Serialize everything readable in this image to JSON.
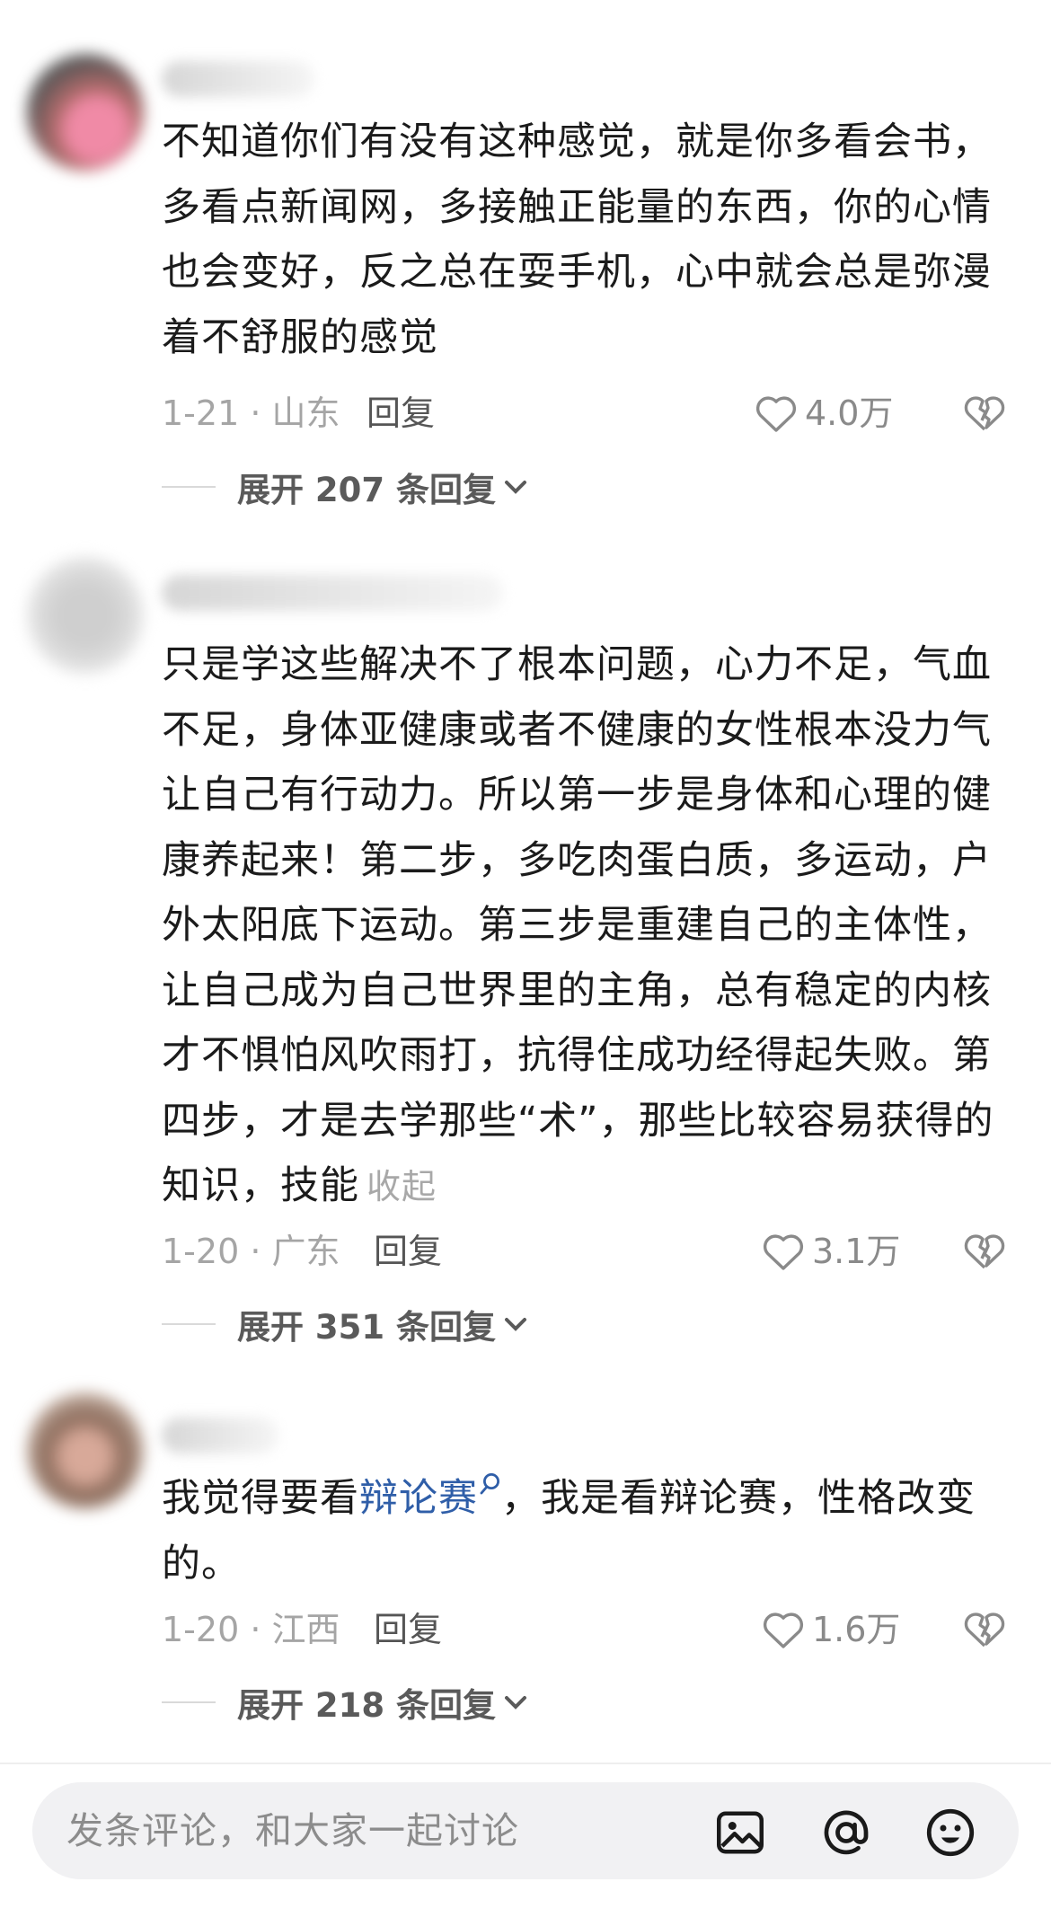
{
  "comments": [
    {
      "text": "不知道你们有没有这种感觉，就是你多看会书，多看点新闻网，多接触正能量的东西，你的心情也会变好，反之总在耍手机，心中就会总是弥漫着不舒服的感觉",
      "date_location": "1-21 · 山东",
      "reply_label": "回复",
      "likes": "4.0万",
      "expand_label": "展开 207 条回复"
    },
    {
      "text": "只是学这些解决不了根本问题，心力不足，气血不足，身体亚健康或者不健康的女性根本没力气让自己有行动力。所以第一步是身体和心理的健康养起来！第二步，多吃肉蛋白质，多运动，户外太阳底下运动。第三步是重建自己的主体性，让自己成为自己世界里的主角，总有稳定的内核才不惧怕风吹雨打，抗得住成功经得起失败。第四步，才是去学那些“术”，那些比较容易获得的知识，技能",
      "collapse_label": "收起",
      "date_location": "1-20 · 广东",
      "reply_label": "回复",
      "likes": "3.1万",
      "expand_label": "展开 351 条回复"
    },
    {
      "text_before": "我觉得要看",
      "link_text": "辩论赛",
      "text_after": "，我是看辩论赛，性格改变的。",
      "date_location": "1-20 · 江西",
      "reply_label": "回复",
      "likes": "1.6万",
      "expand_label": "展开 218 条回复"
    }
  ],
  "comment_input": {
    "placeholder": "发条评论，和大家一起讨论"
  },
  "icons": [
    "heart-outline-icon",
    "broken-heart-icon",
    "chevron-down-icon",
    "image-icon",
    "at-icon",
    "emoji-icon",
    "search-icon"
  ],
  "colors": {
    "link": "#2f5ea8",
    "muted": "#a5a5a5",
    "input_bg": "#f1f1f3"
  }
}
